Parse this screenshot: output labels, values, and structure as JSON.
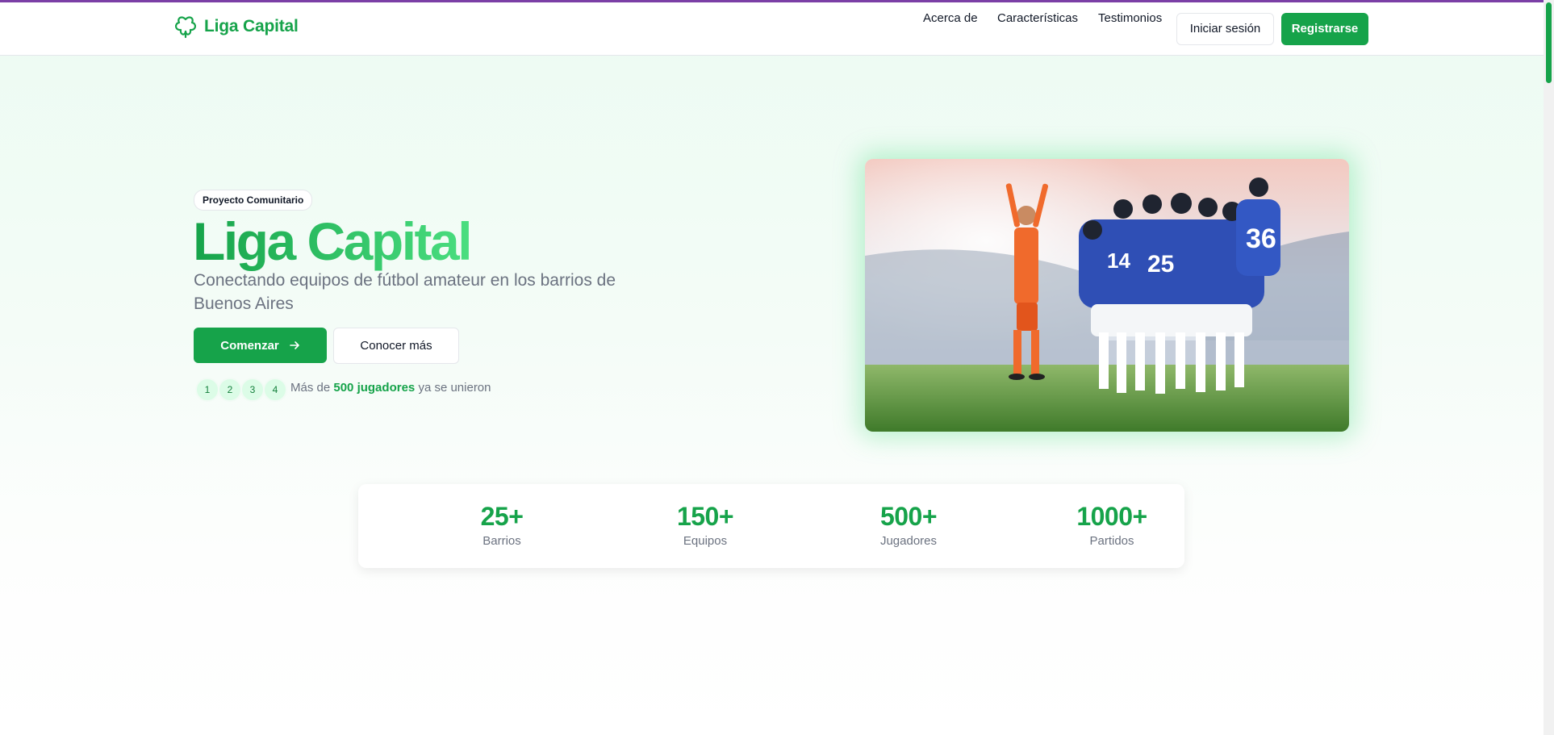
{
  "nav": {
    "brand": "Liga Capital",
    "links": [
      "Acerca de",
      "Características",
      "Testimonios"
    ],
    "login": "Iniciar sesión",
    "register": "Registrarse"
  },
  "hero": {
    "badge": "Proyecto Comunitario",
    "title": "Liga Capital",
    "subtitle": "Conectando equipos de fútbol amateur en los barrios de Buenos Aires",
    "start_button": "Comenzar",
    "more_button": "Conocer más",
    "avatars": [
      "1",
      "2",
      "3",
      "4"
    ],
    "joined_prefix": "Más de",
    "joined_highlight": "500 jugadores",
    "joined_suffix": "ya se unieron",
    "image_icon": "soccer-team-celebration-photo"
  },
  "stats": [
    {
      "value": "25+",
      "label": "Barrios"
    },
    {
      "value": "150+",
      "label": "Equipos"
    },
    {
      "value": "500+",
      "label": "Jugadores"
    },
    {
      "value": "1000+",
      "label": "Partidos"
    }
  ],
  "colors": {
    "accent": "#16a34a",
    "accent_light": "#4ade80",
    "topbar": "#7b3fa6"
  }
}
